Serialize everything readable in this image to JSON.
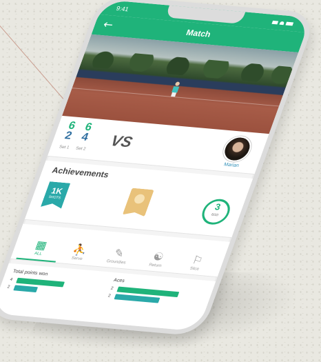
{
  "colors": {
    "accent": "#1fb37a",
    "secondary": "#2aa9a9",
    "court": "#a75c48"
  },
  "status_bar": {
    "time": "9:41"
  },
  "header": {
    "title": "Match",
    "back_icon": "arrow-left-icon"
  },
  "score": {
    "sets": [
      {
        "label": "Set 1",
        "top": "6",
        "bottom": "2"
      },
      {
        "label": "Set 2",
        "top": "6",
        "bottom": "4"
      }
    ],
    "vs_label": "VS",
    "opponent_name": "Marian"
  },
  "achievements": {
    "title": "Achievements",
    "ribbon_value": "1K",
    "ribbon_sub": "SHOTS",
    "circle_value": "3",
    "circle_sub": "6/10"
  },
  "tabs": [
    {
      "label": "ALL",
      "icon": "grid-icon"
    },
    {
      "label": "Serve",
      "icon": "serve-icon"
    },
    {
      "label": "Groundies",
      "icon": "groundstroke-icon"
    },
    {
      "label": "Return",
      "icon": "return-icon"
    },
    {
      "label": "Slice",
      "icon": "slice-icon"
    }
  ],
  "stats": [
    {
      "title": "Total points won",
      "rows": [
        {
          "n": "4",
          "value": 0.62,
          "color": "#1fb37a"
        },
        {
          "n": "2",
          "value": 0.3,
          "color": "#2aa9a9"
        }
      ]
    },
    {
      "title": "Aces",
      "rows": [
        {
          "n": "2",
          "value": 0.8,
          "color": "#1fb37a"
        },
        {
          "n": "2",
          "value": 0.58,
          "color": "#2aa9a9"
        }
      ]
    }
  ]
}
